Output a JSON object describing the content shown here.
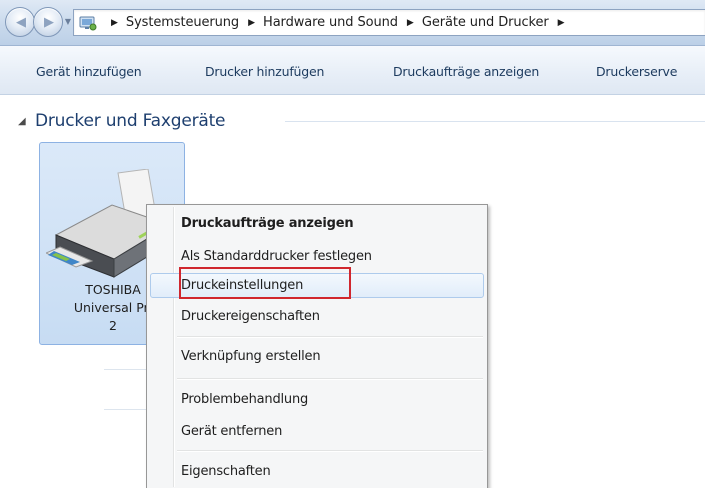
{
  "address_bar": {
    "breadcrumbs": [
      "Systemsteuerung",
      "Hardware und Sound",
      "Geräte und Drucker"
    ],
    "separator_glyph": "▸",
    "back_icon": "arrow-left-icon",
    "forward_icon": "arrow-right-icon",
    "root_icon": "control-panel-icon"
  },
  "command_bar": {
    "items": [
      "Gerät hinzufügen",
      "Drucker hinzufügen",
      "Druckaufträge anzeigen",
      "Druckerserve"
    ]
  },
  "group": {
    "title": "Drucker und Faxgeräte",
    "collapse_glyph": "◢"
  },
  "device": {
    "label_lines": [
      "TOSHIBA",
      "Universal Pri",
      "2"
    ],
    "icon": "printer-icon"
  },
  "context_menu": {
    "items": [
      "Druckaufträge anzeigen",
      "Als Standarddrucker festlegen",
      "Druckeinstellungen",
      "Druckereigenschaften",
      "Verknüpfung erstellen",
      "Problembehandlung",
      "Gerät entfernen",
      "Eigenschaften"
    ],
    "default_item": "Druckaufträge anzeigen",
    "hovered_item": "Druckeinstellungen",
    "highlighted_item": "Druckeinstellungen"
  },
  "colors": {
    "highlight_border": "#d0272e",
    "group_title": "#1e3f6f",
    "command_text": "#1c3a5e",
    "selection_fill": "#c7dcf3"
  }
}
